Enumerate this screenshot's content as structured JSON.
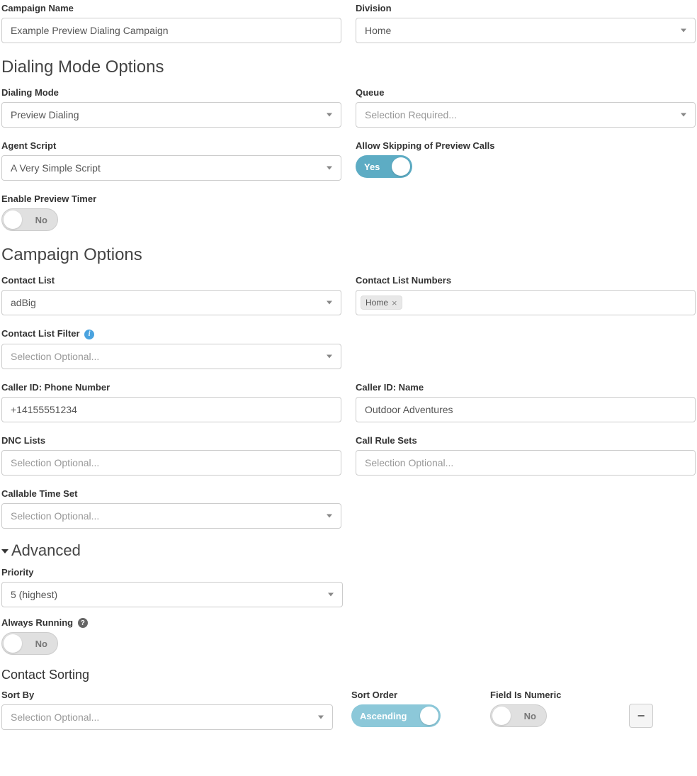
{
  "labels": {
    "campaign_name": "Campaign Name",
    "division": "Division",
    "dialing_mode_options": "Dialing Mode Options",
    "dialing_mode": "Dialing Mode",
    "queue": "Queue",
    "agent_script": "Agent Script",
    "allow_skipping": "Allow Skipping of Preview Calls",
    "enable_preview_timer": "Enable Preview Timer",
    "campaign_options": "Campaign Options",
    "contact_list": "Contact List",
    "contact_list_numbers": "Contact List Numbers",
    "contact_list_filter": "Contact List Filter",
    "caller_id_phone": "Caller ID: Phone Number",
    "caller_id_name": "Caller ID: Name",
    "dnc_lists": "DNC Lists",
    "call_rule_sets": "Call Rule Sets",
    "callable_time_set": "Callable Time Set",
    "advanced": "Advanced",
    "priority": "Priority",
    "always_running": "Always Running",
    "contact_sorting": "Contact Sorting",
    "sort_by": "Sort By",
    "sort_order": "Sort Order",
    "field_is_numeric": "Field Is Numeric"
  },
  "placeholders": {
    "selection_required": "Selection Required...",
    "selection_optional": "Selection Optional..."
  },
  "values": {
    "campaign_name": "Example Preview Dialing Campaign",
    "division": "Home",
    "dialing_mode": "Preview Dialing",
    "queue": "",
    "agent_script": "A Very Simple Script",
    "allow_skipping": "Yes",
    "enable_preview_timer": "No",
    "contact_list": "adBig",
    "contact_list_numbers_tag": "Home",
    "contact_list_filter": "",
    "caller_id_phone": "+14155551234",
    "caller_id_name": "Outdoor Adventures",
    "dnc_lists": "",
    "call_rule_sets": "",
    "callable_time_set": "",
    "priority": "5 (highest)",
    "always_running": "No",
    "sort_by": "",
    "sort_order": "Ascending",
    "field_is_numeric": "No"
  }
}
